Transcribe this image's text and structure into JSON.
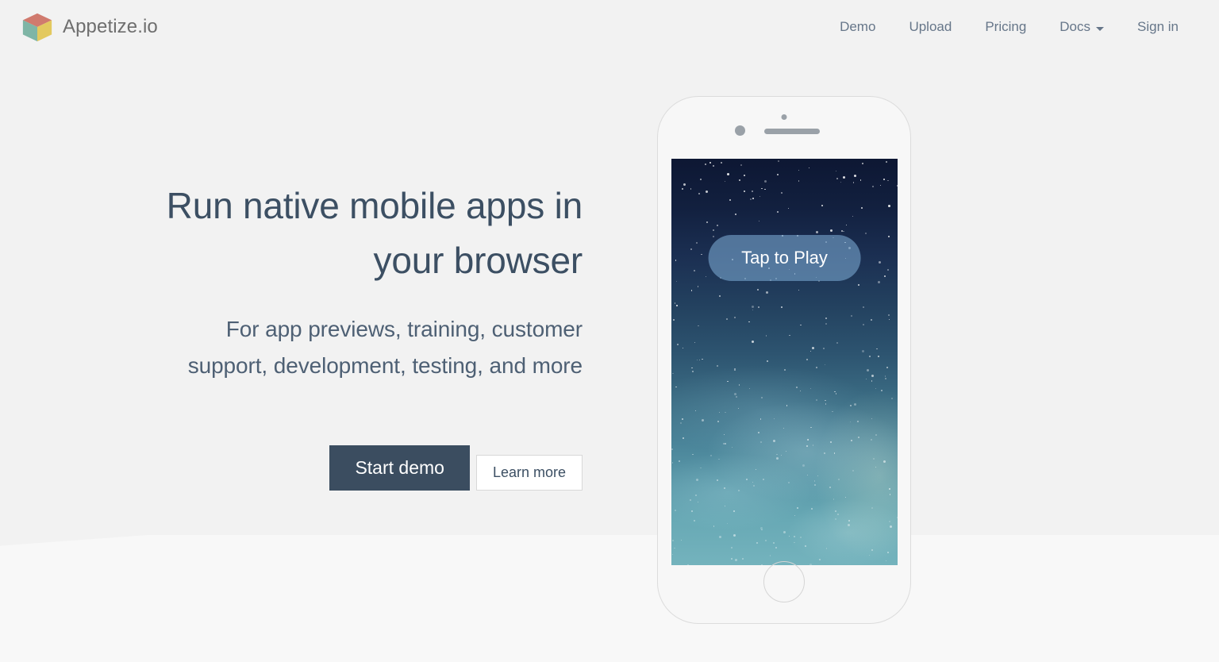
{
  "header": {
    "brand": {
      "name": "Appetize.io",
      "logo_icon": "cube-logo-icon",
      "logo_colors": {
        "top": "#d07a6e",
        "left": "#7fb5a6",
        "right": "#e3c95f"
      }
    },
    "nav": [
      {
        "label": "Demo",
        "name": "nav-link-demo",
        "has_caret": false
      },
      {
        "label": "Upload",
        "name": "nav-link-upload",
        "has_caret": false
      },
      {
        "label": "Pricing",
        "name": "nav-link-pricing",
        "has_caret": false
      },
      {
        "label": "Docs",
        "name": "nav-link-docs",
        "has_caret": true
      },
      {
        "label": "Sign in",
        "name": "nav-link-signin",
        "has_caret": false
      }
    ]
  },
  "hero": {
    "title_line1": "Run native mobile apps in",
    "title_line2": "your browser",
    "subtitle_line1": "For app previews, training, customer",
    "subtitle_line2": "support, development, testing, and more",
    "primary_button": "Start demo",
    "secondary_button": "Learn more"
  },
  "device": {
    "screen_button_label": "Tap to Play",
    "home_button": "home-button",
    "camera": "front-camera",
    "sensor": "proximity-sensor",
    "speaker": "earpiece-speaker"
  },
  "colors": {
    "page_background": "#f2f2f2",
    "text_primary": "#3c4f63",
    "text_muted": "#667689",
    "brand_text": "#6e6e6e",
    "button_primary_bg": "#3b4d60",
    "button_secondary_border": "#d8d8d8",
    "tap_button_bg": "rgba(118,163,204,0.62)"
  }
}
